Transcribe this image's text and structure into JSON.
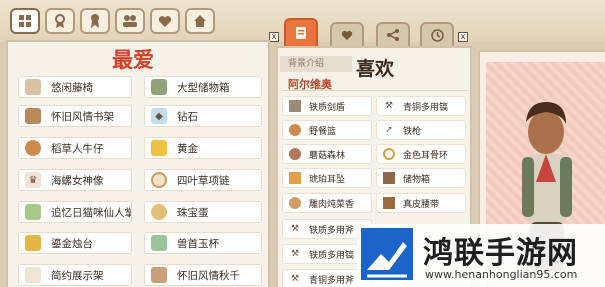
{
  "top_nav": {
    "buttons": [
      "grid-icon",
      "medal-icon",
      "ribbon-icon",
      "portraits-icon",
      "heart-icon",
      "home-icon"
    ]
  },
  "right_tabs": [
    "document-icon",
    "heart-icon",
    "network-icon",
    "clock-icon"
  ],
  "favorites": {
    "title": "最爱",
    "items_left": [
      "悠闲藤椅",
      "怀旧风情书架",
      "稻草人牛仔",
      "海螺女神像",
      "追忆日猫咪仙人掌",
      "鎏金烛台",
      "简约展示架"
    ],
    "items_right": [
      "大型储物箱",
      "钻石",
      "黄金",
      "四叶草项链",
      "珠宝蛋",
      "兽首玉杯",
      "怀旧风情秋千"
    ]
  },
  "likes": {
    "tab_label": "背景介绍",
    "title": "喜欢",
    "npc_name": "阿尔维奥",
    "items_left": [
      "铁质剑盾",
      "野餐篮",
      "蘑菇森林",
      "琥珀耳坠",
      "雕肉炖菜香",
      "铁质多用斧",
      "铁质多用镐",
      "青铜多用斧"
    ],
    "items_right": [
      "青铜多用镐",
      "铁枪",
      "金色耳骨环",
      "储物箱",
      "真皮腰带"
    ]
  },
  "watermark": {
    "title": "鸿联手游网",
    "url": "www.henanhonglian95.com"
  },
  "colors": {
    "accent_red": "#d2432e",
    "tab_orange": "#e9743d",
    "panel_bg": "#f8f3ea"
  }
}
